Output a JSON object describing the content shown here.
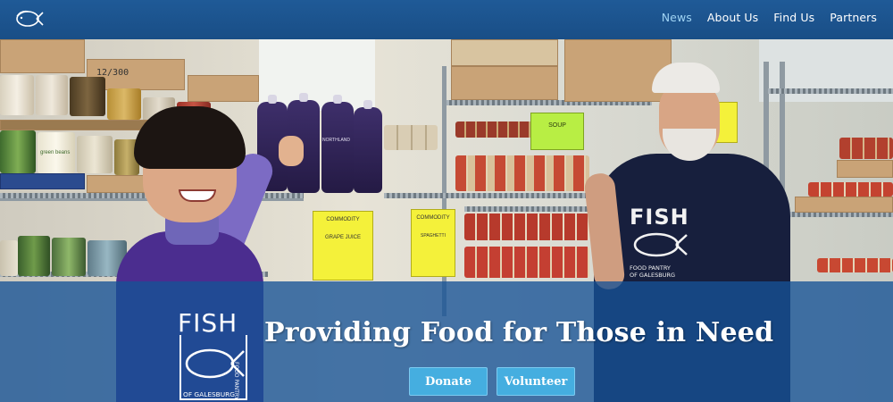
{
  "nav": {
    "items": [
      {
        "label": "News",
        "active": true
      },
      {
        "label": "About Us",
        "active": false
      },
      {
        "label": "Find Us",
        "active": false
      },
      {
        "label": "Partners",
        "active": false
      }
    ]
  },
  "hero": {
    "headline": "Providing Food for Those in Need",
    "buttons": {
      "donate": "Donate",
      "volunteer": "Volunteer"
    },
    "logo": {
      "name": "FISH",
      "subtitle": "OF GALESBURG",
      "side_text": "FOOD PANTRY"
    },
    "shirt_logo": {
      "name": "FISH",
      "line1": "FOOD PANTRY",
      "line2": "OF GALESBURG"
    },
    "shelf_labels": {
      "box_number": "12/300",
      "juice_brand": "NORTHLAND",
      "can_label": "green beans"
    },
    "signs": {
      "left_title": "COMMODITY",
      "left_item": "GRAPE JUICE",
      "right_title": "COMMODITY",
      "right_item": "SPAGHETTI",
      "green_title": "SOUP"
    }
  },
  "colors": {
    "nav_bg": "#1a4f86",
    "nav_active": "#9fd3f3",
    "overlay": "#1652a0",
    "button": "#45aee0"
  }
}
